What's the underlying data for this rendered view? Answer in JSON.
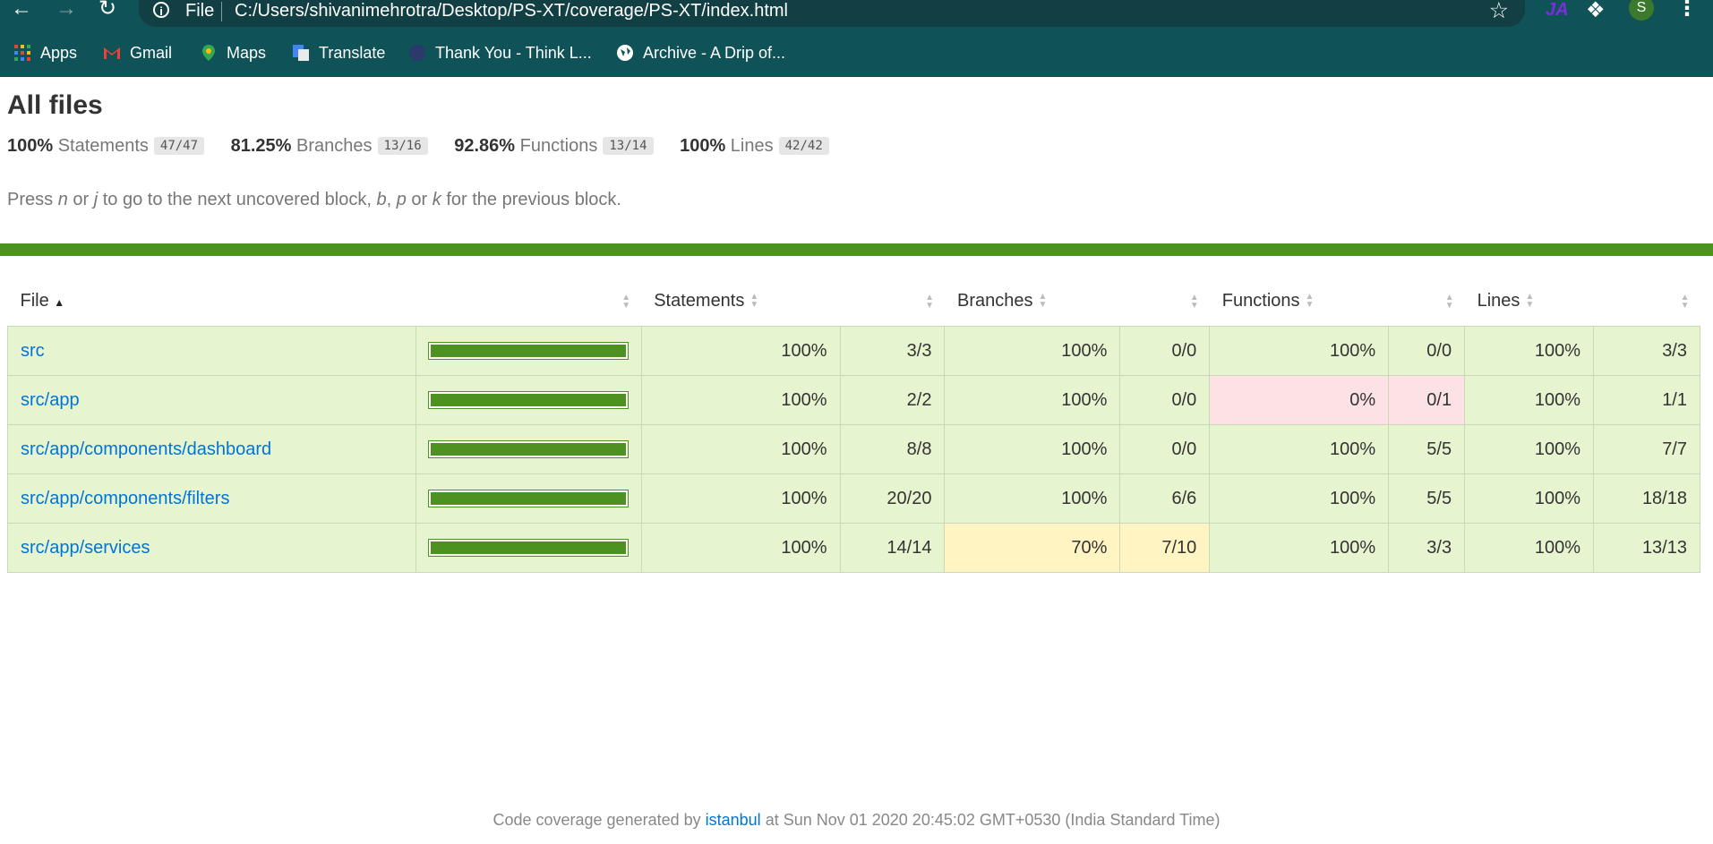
{
  "browser": {
    "url_scheme": "File",
    "url": "C:/Users/shivanimehrotra/Desktop/PS-XT/coverage/PS-XT/index.html",
    "avatar_letter": "S",
    "ext_label": "JA",
    "bookmarks": [
      {
        "label": "Apps",
        "icon": "apps-grid-icon"
      },
      {
        "label": "Gmail",
        "icon": "gmail-icon"
      },
      {
        "label": "Maps",
        "icon": "maps-icon"
      },
      {
        "label": "Translate",
        "icon": "translate-icon"
      },
      {
        "label": "Thank You - Think L...",
        "icon": "thinkific-icon"
      },
      {
        "label": "Archive - A Drip of...",
        "icon": "globe-icon"
      }
    ]
  },
  "report": {
    "title": "All files",
    "summary": [
      {
        "pct": "100%",
        "label": "Statements",
        "fraction": "47/47"
      },
      {
        "pct": "81.25%",
        "label": "Branches",
        "fraction": "13/16"
      },
      {
        "pct": "92.86%",
        "label": "Functions",
        "fraction": "13/14"
      },
      {
        "pct": "100%",
        "label": "Lines",
        "fraction": "42/42"
      }
    ],
    "hint_parts": [
      "Press ",
      "n",
      " or ",
      "j",
      " to go to the next uncovered block, ",
      "b",
      ", ",
      "p",
      " or ",
      "k",
      " for the previous block."
    ],
    "columns": [
      "File",
      "Statements",
      "Branches",
      "Functions",
      "Lines"
    ],
    "rows": [
      {
        "file": "src",
        "coverage_fraction": 1.0,
        "stmt_pct": "100%",
        "stmt": "3/3",
        "br_pct": "100%",
        "br": "0/0",
        "fn_pct": "100%",
        "fn": "0/0",
        "ln_pct": "100%",
        "ln": "3/3",
        "br_level": "high",
        "fn_level": "high"
      },
      {
        "file": "src/app",
        "coverage_fraction": 1.0,
        "stmt_pct": "100%",
        "stmt": "2/2",
        "br_pct": "100%",
        "br": "0/0",
        "fn_pct": "0%",
        "fn": "0/1",
        "ln_pct": "100%",
        "ln": "1/1",
        "br_level": "high",
        "fn_level": "low"
      },
      {
        "file": "src/app/components/dashboard",
        "coverage_fraction": 1.0,
        "stmt_pct": "100%",
        "stmt": "8/8",
        "br_pct": "100%",
        "br": "0/0",
        "fn_pct": "100%",
        "fn": "5/5",
        "ln_pct": "100%",
        "ln": "7/7",
        "br_level": "high",
        "fn_level": "high"
      },
      {
        "file": "src/app/components/filters",
        "coverage_fraction": 1.0,
        "stmt_pct": "100%",
        "stmt": "20/20",
        "br_pct": "100%",
        "br": "6/6",
        "fn_pct": "100%",
        "fn": "5/5",
        "ln_pct": "100%",
        "ln": "18/18",
        "br_level": "high",
        "fn_level": "high"
      },
      {
        "file": "src/app/services",
        "coverage_fraction": 1.0,
        "stmt_pct": "100%",
        "stmt": "14/14",
        "br_pct": "70%",
        "br": "7/10",
        "fn_pct": "100%",
        "fn": "3/3",
        "ln_pct": "100%",
        "ln": "13/13",
        "br_level": "medium",
        "fn_level": "high"
      }
    ],
    "footer_prefix": "Code coverage generated by ",
    "footer_link": "istanbul",
    "footer_suffix": " at Sun Nov 01 2020 20:45:02 GMT+0530 (India Standard Time)"
  },
  "colors": {
    "chrome": "#0f5257",
    "bar_green": "#4d9121",
    "high_bg": "#e6f5d0",
    "medium_bg": "#fff4c2",
    "low_bg": "#fce1e5",
    "link": "#0074d9"
  }
}
